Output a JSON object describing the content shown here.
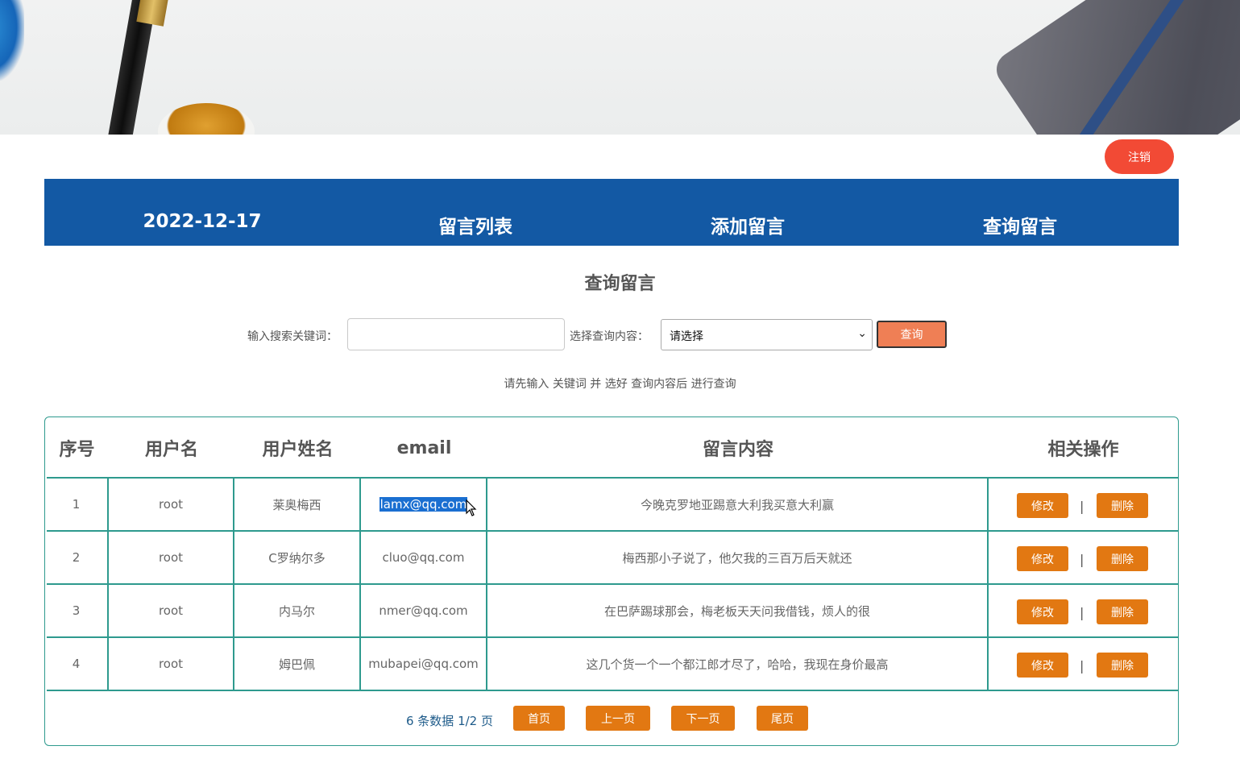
{
  "header": {
    "logout_label": "注销"
  },
  "nav": {
    "date": "2022-12-17",
    "items": [
      "留言列表",
      "添加留言",
      "查询留言"
    ]
  },
  "page_title": "查询留言",
  "search": {
    "keyword_label": "输入搜索关键词：",
    "keyword_value": "",
    "content_label": "选择查询内容：",
    "select_value": "请选择",
    "query_button": "查询",
    "hint": "请先输入 关键词 并 选好 查询内容后 进行查询"
  },
  "table": {
    "headers": [
      "序号",
      "用户名",
      "用户姓名",
      "email",
      "留言内容",
      "相关操作"
    ],
    "rows": [
      {
        "id": "1",
        "username": "root",
        "name": "莱奥梅西",
        "email": "lamx@qq.com",
        "content": "今晚克罗地亚踢意大利我买意大利赢"
      },
      {
        "id": "2",
        "username": "root",
        "name": "C罗纳尔多",
        "email": "cluo@qq.com",
        "content": "梅西那小子说了，他欠我的三百万后天就还"
      },
      {
        "id": "3",
        "username": "root",
        "name": "内马尔",
        "email": "nmer@qq.com",
        "content": "在巴萨踢球那会，梅老板天天问我借钱，烦人的很"
      },
      {
        "id": "4",
        "username": "root",
        "name": "姆巴佩",
        "email": "mubapei@qq.com",
        "content": "这几个货一个一个都江郎才尽了，哈哈，我现在身价最高"
      }
    ],
    "edit_label": "修改",
    "delete_label": "删除",
    "separator": "|"
  },
  "pagination": {
    "info": "6 条数据 1/2 页",
    "first": "首页",
    "prev": "上一页",
    "next": "下一页",
    "last": "尾页"
  },
  "colors": {
    "nav_bg": "#1359a4",
    "logout_bg": "#f24a35",
    "action_btn": "#e27812",
    "query_btn": "#ef7f55",
    "table_border": "#2e9a8e"
  }
}
